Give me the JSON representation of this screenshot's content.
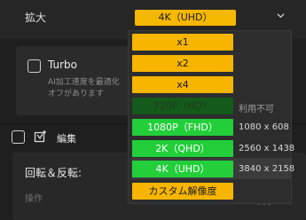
{
  "scale_row": {
    "label": "拡大",
    "selected": "4K（UHD）"
  },
  "turbo": {
    "label": "Turbo",
    "description_line1": "AI加工速度を最適化",
    "description_line2": "オフがあります"
  },
  "edit": {
    "label": "編集"
  },
  "rotate": {
    "label": "回転＆反転:",
    "operation_label": "操作",
    "more": "..."
  },
  "dropdown": {
    "options": [
      {
        "label": "x1",
        "resolution": ""
      },
      {
        "label": "x2",
        "resolution": ""
      },
      {
        "label": "x4",
        "resolution": ""
      },
      {
        "label": "720P（HD）",
        "resolution": "利用不可"
      },
      {
        "label": "1080P（FHD）",
        "resolution": "1080 x 608"
      },
      {
        "label": "2K（QHD）",
        "resolution": "2560 x 1438"
      },
      {
        "label": "4K（UHD）",
        "resolution": "3840 x 2158"
      },
      {
        "label": "カスタム解像度",
        "resolution": ""
      }
    ]
  },
  "colors": {
    "accent_yellow": "#f7b500",
    "available_green": "#22cf3a",
    "unavailable_green": "#145a1a",
    "background": "#1f1f1f"
  },
  "icons": {
    "chevron": "chevron-down-icon",
    "edit": "edit-icon"
  }
}
